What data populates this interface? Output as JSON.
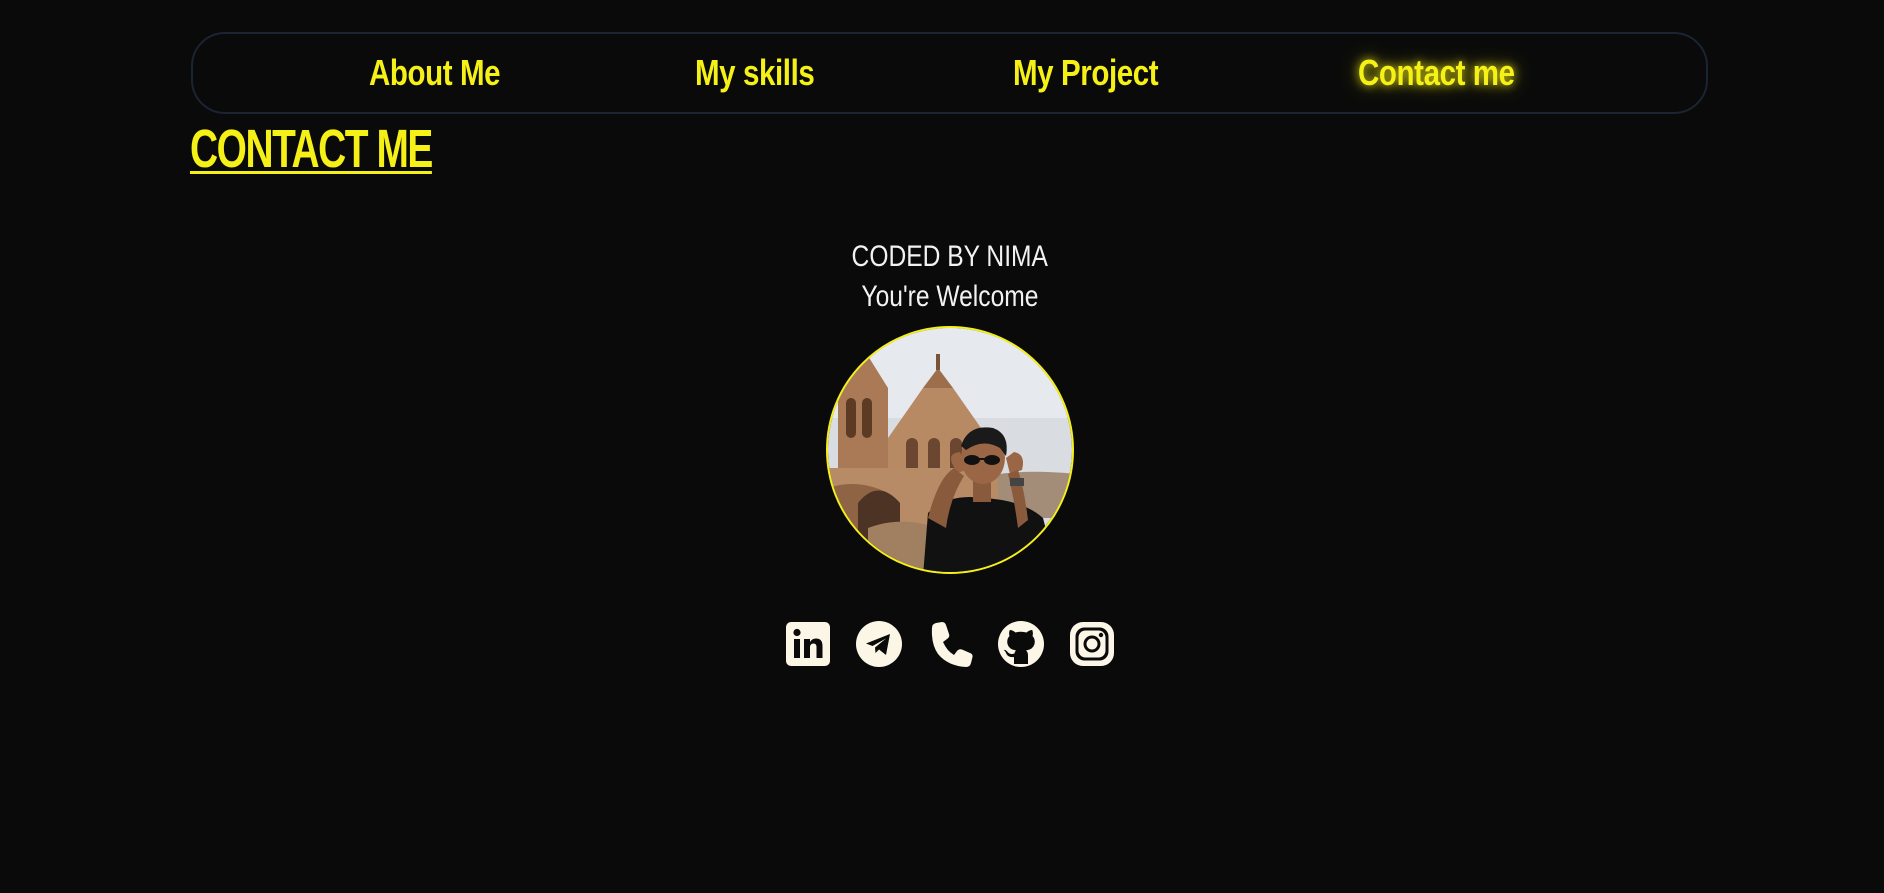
{
  "nav": {
    "items": [
      {
        "label": "About Me"
      },
      {
        "label": "My skills"
      },
      {
        "label": "My Project"
      },
      {
        "label": "Contact me"
      }
    ],
    "active": "Contact me"
  },
  "section": {
    "title": "CONTACT ME"
  },
  "credit": {
    "line1": "CODED BY NIMA",
    "line2": "You're Welcome"
  },
  "avatar": {
    "icon": "profile-photo"
  },
  "social": [
    {
      "icon": "linkedin-icon"
    },
    {
      "icon": "telegram-icon"
    },
    {
      "icon": "phone-icon"
    },
    {
      "icon": "github-icon"
    },
    {
      "icon": "instagram-icon"
    }
  ],
  "colors": {
    "background": "#0a0a0a",
    "accent": "#f5f016",
    "text": "#f2f2f2",
    "icon": "#fbf6e6",
    "nav_border": "#1b2433"
  }
}
